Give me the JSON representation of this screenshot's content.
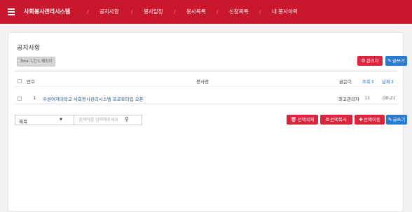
{
  "navbar": {
    "brand": "사회봉사관리시스템",
    "items": [
      "공지사항",
      "봉사일정",
      "봉사목록",
      "신청목록",
      "내 봉사이력"
    ],
    "separator": "/"
  },
  "notice": {
    "title": "공지사항",
    "total_text": "Total 1건 1 페이지",
    "admin_button": "관리자",
    "write_button": "글쓰기",
    "columns": {
      "number": "번호",
      "subject": "봉사명",
      "author": "글쓴이",
      "views": "조회",
      "date": "날짜"
    },
    "rows": [
      {
        "number": "1",
        "title": "수원여자대학교 사회봉사관리시스템 프로토타입 오픈",
        "author": "최고관리자",
        "views": "11",
        "date": "08-21"
      }
    ]
  },
  "search": {
    "select_value": "제목",
    "placeholder": "검색어를 입력해주세요"
  },
  "actions": {
    "delete": "선택삭제",
    "copy": "선택복사",
    "move": "선택이동",
    "write": "글쓰기"
  },
  "icons": {
    "menu": "hamburger-icon",
    "admin": "gear-icon",
    "write": "pencil-icon",
    "search": "search-icon",
    "sort": "sort-icon",
    "delete": "trash-icon",
    "copy": "copy-icon",
    "move": "plus-icon",
    "dropdown": "caret-down-icon"
  },
  "colors": {
    "brand": "#c9172d",
    "accent_red": "#d7263d",
    "accent_blue": "#2a7ad2"
  }
}
